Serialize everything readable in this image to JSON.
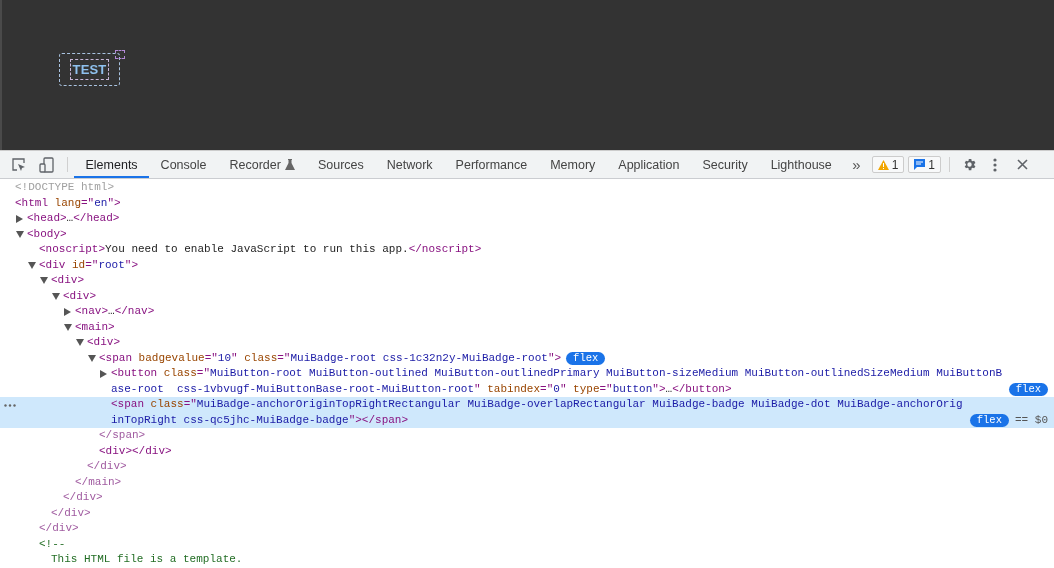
{
  "viewport": {
    "button_label": "TEST",
    "badge_dot": true
  },
  "toolbar": {
    "tabs": [
      {
        "label": "Elements",
        "selected": true,
        "experimental": false
      },
      {
        "label": "Console",
        "selected": false,
        "experimental": false
      },
      {
        "label": "Recorder",
        "selected": false,
        "experimental": true
      },
      {
        "label": "Sources",
        "selected": false,
        "experimental": false
      },
      {
        "label": "Network",
        "selected": false,
        "experimental": false
      },
      {
        "label": "Performance",
        "selected": false,
        "experimental": false
      },
      {
        "label": "Memory",
        "selected": false,
        "experimental": false
      },
      {
        "label": "Application",
        "selected": false,
        "experimental": false
      },
      {
        "label": "Security",
        "selected": false,
        "experimental": false
      },
      {
        "label": "Lighthouse",
        "selected": false,
        "experimental": false
      }
    ],
    "more": "»",
    "warnings": "1",
    "messages": "1"
  },
  "dom_tree": [
    {
      "selected": false,
      "line": [
        {
          "kind": "doctype",
          "t": "<!DOCTYPE html>"
        }
      ]
    },
    {
      "selected": false,
      "line": [
        {
          "kind": "tag",
          "t": "<html "
        },
        {
          "kind": "attr",
          "t": "lang"
        },
        {
          "kind": "tag",
          "t": "=\""
        },
        {
          "kind": "value",
          "t": "en"
        },
        {
          "kind": "tag",
          "t": "\">"
        }
      ],
      "children": [
        {
          "expanded": false,
          "selected": false,
          "line": [
            {
              "kind": "tag",
              "t": "<head>"
            },
            {
              "kind": "text",
              "t": "…"
            },
            {
              "kind": "tag",
              "t": "</head>"
            }
          ]
        },
        {
          "expanded": true,
          "selected": false,
          "line": [
            {
              "kind": "tag",
              "t": "<body>"
            }
          ],
          "children": [
            {
              "selected": false,
              "line": [
                {
                  "kind": "tag",
                  "t": "<noscript>"
                },
                {
                  "kind": "text",
                  "t": "You need to enable JavaScript to run this app."
                },
                {
                  "kind": "tag",
                  "t": "</noscript>"
                }
              ]
            },
            {
              "expanded": true,
              "selected": false,
              "line": [
                {
                  "kind": "tag",
                  "t": "<div "
                },
                {
                  "kind": "attr",
                  "t": "id"
                },
                {
                  "kind": "tag",
                  "t": "=\""
                },
                {
                  "kind": "value",
                  "t": "root"
                },
                {
                  "kind": "tag",
                  "t": "\">"
                }
              ],
              "closing": "</div>",
              "children": [
                {
                  "expanded": true,
                  "selected": false,
                  "line": [
                    {
                      "kind": "tag",
                      "t": "<div>"
                    }
                  ],
                  "closing": "</div>",
                  "children": [
                    {
                      "expanded": true,
                      "selected": false,
                      "line": [
                        {
                          "kind": "tag",
                          "t": "<div>"
                        }
                      ],
                      "closing": "</div>",
                      "children": [
                        {
                          "expanded": false,
                          "selected": false,
                          "line": [
                            {
                              "kind": "tag",
                              "t": "<nav>"
                            },
                            {
                              "kind": "text",
                              "t": "…"
                            },
                            {
                              "kind": "tag",
                              "t": "</nav>"
                            }
                          ]
                        },
                        {
                          "expanded": true,
                          "selected": false,
                          "line": [
                            {
                              "kind": "tag",
                              "t": "<main>"
                            }
                          ],
                          "closing": "</main>",
                          "children": [
                            {
                              "expanded": true,
                              "selected": false,
                              "line": [
                                {
                                  "kind": "tag",
                                  "t": "<div>"
                                }
                              ],
                              "closing": "</div>",
                              "children": [
                                {
                                  "expanded": true,
                                  "selected": false,
                                  "badge": "flex",
                                  "line": [
                                    {
                                      "kind": "tag",
                                      "t": "<span "
                                    },
                                    {
                                      "kind": "attr",
                                      "t": "badgevalue"
                                    },
                                    {
                                      "kind": "tag",
                                      "t": "=\""
                                    },
                                    {
                                      "kind": "value",
                                      "t": "10"
                                    },
                                    {
                                      "kind": "tag",
                                      "t": "\" "
                                    },
                                    {
                                      "kind": "attr",
                                      "t": "class"
                                    },
                                    {
                                      "kind": "tag",
                                      "t": "=\""
                                    },
                                    {
                                      "kind": "value",
                                      "t": "MuiBadge-root css-1c32n2y-MuiBadge-root"
                                    },
                                    {
                                      "kind": "tag",
                                      "t": "\">"
                                    }
                                  ],
                                  "closing": "</span>",
                                  "children": [
                                    {
                                      "expanded": false,
                                      "selected": false,
                                      "badge": "flex",
                                      "line": [
                                        {
                                          "kind": "tag",
                                          "t": "<button "
                                        },
                                        {
                                          "kind": "attr",
                                          "t": "class"
                                        },
                                        {
                                          "kind": "tag",
                                          "t": "=\""
                                        },
                                        {
                                          "kind": "value",
                                          "t": "MuiButton-root MuiButton-outlined MuiButton-outlinedPrimary MuiButton-sizeMedium MuiButton-outlinedSizeMedium MuiButtonBase-root  css-1vbvugf-MuiButtonBase-root-MuiButton-root"
                                        },
                                        {
                                          "kind": "tag",
                                          "t": "\" "
                                        },
                                        {
                                          "kind": "attr",
                                          "t": "tabindex"
                                        },
                                        {
                                          "kind": "tag",
                                          "t": "=\""
                                        },
                                        {
                                          "kind": "value",
                                          "t": "0"
                                        },
                                        {
                                          "kind": "tag",
                                          "t": "\" "
                                        },
                                        {
                                          "kind": "attr",
                                          "t": "type"
                                        },
                                        {
                                          "kind": "tag",
                                          "t": "=\""
                                        },
                                        {
                                          "kind": "value",
                                          "t": "button"
                                        },
                                        {
                                          "kind": "tag",
                                          "t": "\">"
                                        },
                                        {
                                          "kind": "text",
                                          "t": "…"
                                        },
                                        {
                                          "kind": "tag",
                                          "t": "</button>"
                                        }
                                      ]
                                    },
                                    {
                                      "selected": true,
                                      "badge": "flex",
                                      "marker": "== $0",
                                      "line": [
                                        {
                                          "kind": "tag",
                                          "t": "<span "
                                        },
                                        {
                                          "kind": "attr",
                                          "t": "class"
                                        },
                                        {
                                          "kind": "tag",
                                          "t": "=\""
                                        },
                                        {
                                          "kind": "value",
                                          "t": "MuiBadge-anchorOriginTopRightRectangular MuiBadge-overlapRectangular MuiBadge-badge MuiBadge-dot MuiBadge-anchorOriginTopRight css-qc5jhc-MuiBadge-badge"
                                        },
                                        {
                                          "kind": "tag",
                                          "t": "\"></span>"
                                        }
                                      ]
                                    }
                                  ]
                                },
                                {
                                  "selected": false,
                                  "line": [
                                    {
                                      "kind": "tag",
                                      "t": "<div></div>"
                                    }
                                  ]
                                }
                              ]
                            }
                          ]
                        }
                      ]
                    }
                  ]
                }
              ]
            },
            {
              "selected": false,
              "line": [
                {
                  "kind": "comment",
                  "t": "<!--"
                }
              ],
              "children": [
                {
                  "selected": false,
                  "line": [
                    {
                      "kind": "comment",
                      "t": "This HTML file is a template."
                    }
                  ]
                }
              ]
            }
          ]
        }
      ]
    }
  ]
}
